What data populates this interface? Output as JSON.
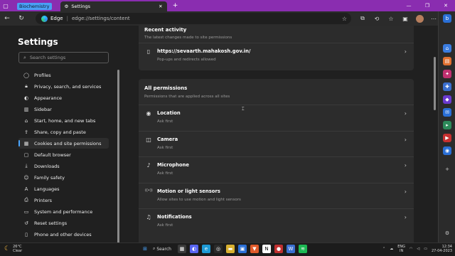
{
  "titlebar": {
    "workspace_label": "Biochemistry",
    "active_tab_title": "Settings",
    "new_tab_glyph": "+",
    "window_controls": [
      "—",
      "❐",
      "✕"
    ]
  },
  "navbar": {
    "browser_name": "Edge",
    "separator": "|",
    "url": "edge://settings/content"
  },
  "leftnav": {
    "title": "Settings",
    "search_placeholder": "Search settings",
    "items": [
      {
        "label": "Profiles",
        "icon": "profile-icon"
      },
      {
        "label": "Privacy, search, and services",
        "icon": "lock-icon"
      },
      {
        "label": "Appearance",
        "icon": "appearance-icon"
      },
      {
        "label": "Sidebar",
        "icon": "sidebar-icon"
      },
      {
        "label": "Start, home, and new tabs",
        "icon": "home-icon"
      },
      {
        "label": "Share, copy and paste",
        "icon": "share-icon"
      },
      {
        "label": "Cookies and site permissions",
        "icon": "cookies-icon",
        "selected": true
      },
      {
        "label": "Default browser",
        "icon": "browser-icon"
      },
      {
        "label": "Downloads",
        "icon": "download-icon"
      },
      {
        "label": "Family safety",
        "icon": "family-icon"
      },
      {
        "label": "Languages",
        "icon": "language-icon"
      },
      {
        "label": "Printers",
        "icon": "printer-icon"
      },
      {
        "label": "System and performance",
        "icon": "system-icon"
      },
      {
        "label": "Reset settings",
        "icon": "reset-icon"
      },
      {
        "label": "Phone and other devices",
        "icon": "phone-icon"
      }
    ]
  },
  "main": {
    "recent": {
      "title": "Recent activity",
      "subtitle": "The latest changes made to site permissions",
      "site": "https://sevaarth.mahakosh.gov.in/",
      "site_detail": "Pop-ups and redirects allowed"
    },
    "permissions": {
      "title": "All permissions",
      "subtitle": "Permissions that are applied across all sites",
      "rows": [
        {
          "label": "Location",
          "sub": "Ask first",
          "icon": "location-icon"
        },
        {
          "label": "Camera",
          "sub": "Ask first",
          "icon": "camera-icon"
        },
        {
          "label": "Microphone",
          "sub": "Ask first",
          "icon": "microphone-icon"
        },
        {
          "label": "Motion or light sensors",
          "sub": "Allow sites to use motion and light sensors",
          "icon": "sensor-icon"
        },
        {
          "label": "Notifications",
          "sub": "Ask first",
          "icon": "bell-icon"
        }
      ]
    }
  },
  "taskbar": {
    "weather_temp": "26°C",
    "weather_desc": "Clear",
    "search_label": "Search",
    "lang_top": "ENG",
    "lang_bottom": "IN",
    "time": "12:34",
    "date": "27-04-2023"
  },
  "colors": {
    "titlebar": "#8a2db0",
    "accent": "#4aa6ff",
    "background": "#202020",
    "card": "#2c2c2c"
  }
}
